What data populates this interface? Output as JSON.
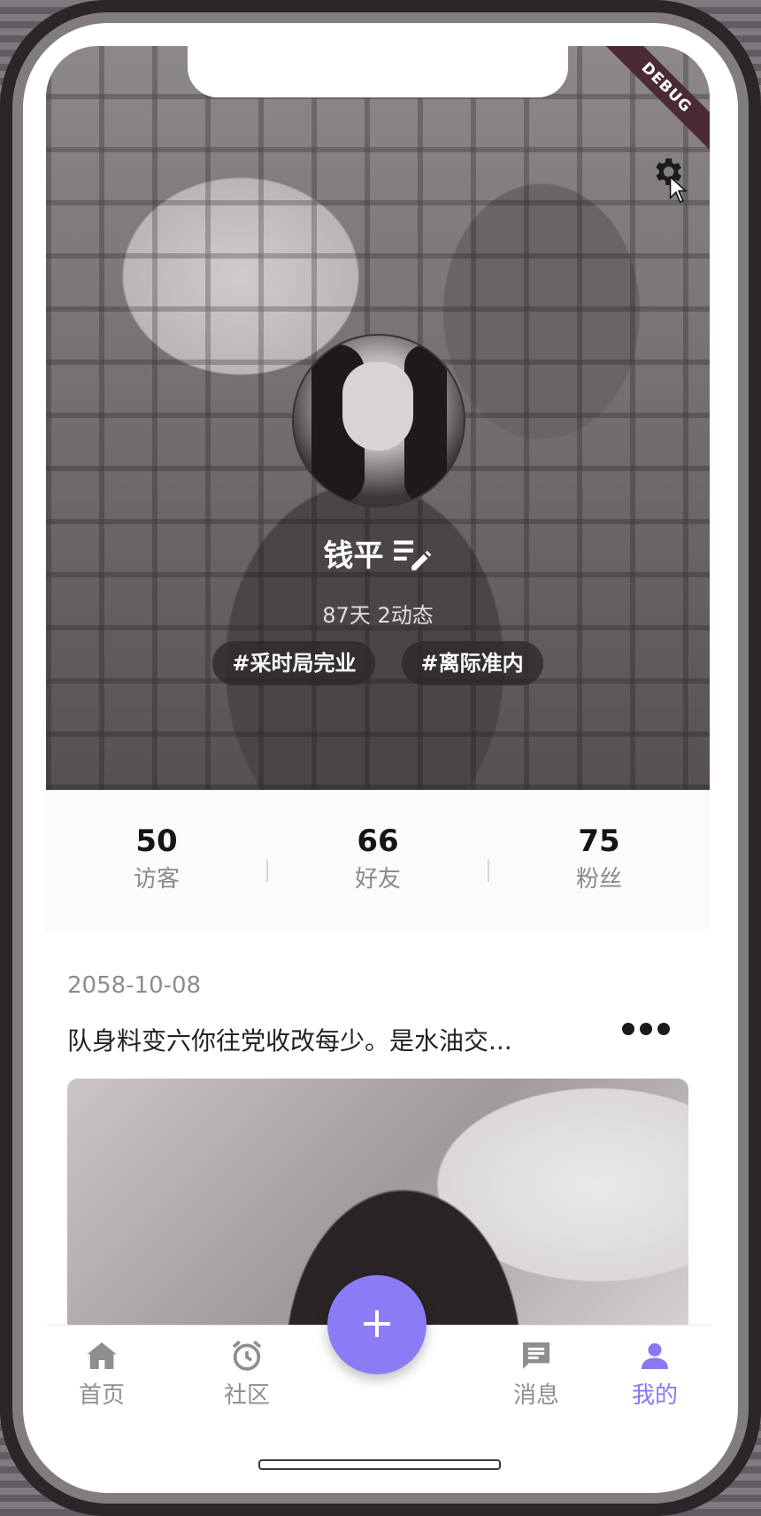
{
  "debug_banner": "DEBUG",
  "profile": {
    "name": "钱平",
    "subtitle": "87天 2动态",
    "tags": [
      "#采时局完业",
      "#离际准内"
    ]
  },
  "stats": [
    {
      "value": "50",
      "label": "访客"
    },
    {
      "value": "66",
      "label": "好友"
    },
    {
      "value": "75",
      "label": "粉丝"
    }
  ],
  "post": {
    "date": "2058-10-08",
    "text": "队身料变六你往党收改每少。是水油交..."
  },
  "tabbar": {
    "items": [
      {
        "label": "首页",
        "icon": "home-icon"
      },
      {
        "label": "社区",
        "icon": "alarm-clock-icon"
      },
      {
        "label": "消息",
        "icon": "message-icon"
      },
      {
        "label": "我的",
        "icon": "person-icon"
      }
    ],
    "fab_label": "+",
    "active_index": 3,
    "accent_color": "#8b7cf6"
  }
}
